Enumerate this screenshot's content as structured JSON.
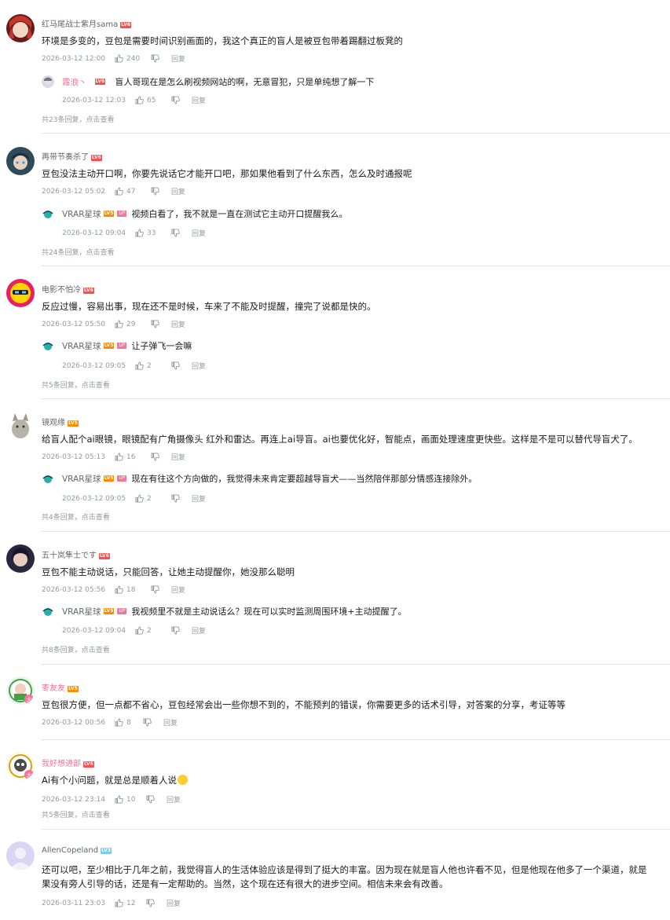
{
  "comments": [
    {
      "user": "红马尾战士紫月sama",
      "level": "LV6",
      "text": "环境是多变的，豆包是需要时间识别画面的，我这个真正的盲人是被豆包带着踢翻过板凳的",
      "time": "2026-03-12 12:00",
      "likes": "240",
      "reply_label": "回复",
      "reply": {
        "user": "霧浪丶",
        "level": "LV6",
        "up": "",
        "text": "盲人哥现在是怎么刷视频网站的啊，无意冒犯，只是单纯想了解一下",
        "time": "2026-03-12 12:03",
        "likes": "65",
        "reply_label": "回复"
      },
      "more": "共23条回复，点击查看"
    },
    {
      "user": "再带节奏杀了",
      "level": "LV6",
      "text": "豆包没法主动开口啊，你要先说话它才能开口吧，那如果他看到了什么东西，怎么及时通报呢",
      "time": "2026-03-12 05:02",
      "likes": "47",
      "reply_label": "回复",
      "reply": {
        "user": "VRAR星球",
        "level": "LV5",
        "up": "UP",
        "text": "视频白看了，我不就是一直在测试它主动开口提醒我么。",
        "time": "2026-03-12 09:04",
        "likes": "33",
        "reply_label": "回复"
      },
      "more": "共24条回复，点击查看"
    },
    {
      "user": "电影不怕冷",
      "level": "LV6",
      "text": "反应过慢，容易出事，现在还不是时候，车来了不能及时提醒，撞完了说都是快的。",
      "time": "2026-03-12 05:50",
      "likes": "29",
      "reply_label": "回复",
      "reply": {
        "user": "VRAR星球",
        "level": "LV5",
        "up": "UP",
        "text": "让子弹飞一会嘛",
        "time": "2026-03-12 09:05",
        "likes": "2",
        "reply_label": "回复"
      },
      "more": "共5条回复，点击查看"
    },
    {
      "user": "镜观缘",
      "level": "LV5",
      "text": "给盲人配个ai眼镜，眼镜配有广角摄像头 红外和雷达。再连上ai导盲。ai也要优化好，智能点，画面处理速度更快些。这样是不是可以替代导盲犬了。",
      "time": "2026-03-12 05:13",
      "likes": "16",
      "reply_label": "回复",
      "reply": {
        "user": "VRAR星球",
        "level": "LV5",
        "up": "UP",
        "text": "现在有往这个方向做的，我觉得未来肯定要超越导盲犬——当然陪伴那部分情感连接除外。",
        "time": "2026-03-12 09:05",
        "likes": "2",
        "reply_label": "回复"
      },
      "more": "共4条回复，点击查看"
    },
    {
      "user": "五十岚隼士です",
      "level": "LV6",
      "text": "豆包不能主动说话，只能回答，让她主动提醒你，她没那么聪明",
      "time": "2026-03-12 05:56",
      "likes": "18",
      "reply_label": "回复",
      "reply": {
        "user": "VRAR星球",
        "level": "LV5",
        "up": "UP",
        "text": "我视频里不就是主动说话么？现在可以实时监测周围环境+主动提醒了。",
        "time": "2026-03-12 09:04",
        "likes": "2",
        "reply_label": "回复"
      },
      "more": "共8条回复，点击查看"
    },
    {
      "user": "枣友友",
      "level": "LV5",
      "text": "豆包很方便，但一点都不省心，豆包经常会出一些你想不到的，不能预判的错误，你需要更多的话术引导，对答案的分享，考证等等",
      "time": "2026-03-12 00:56",
      "likes": "8",
      "reply_label": "回复"
    },
    {
      "user": "我好想进部",
      "level": "LV6",
      "text": "Ai有个小问题，就是总是顺着人说",
      "time": "2026-03-12 23:14",
      "likes": "10",
      "reply_label": "回复",
      "more": "共5条回复，点击查看"
    },
    {
      "user": "AllenCopeland",
      "level": "LV3",
      "text": "还可以吧，至少相比于几年之前，我觉得盲人的生活体验应该是得到了挺大的丰富。因为现在就是盲人他也许看不见，但是他现在他多了一个渠道，就是",
      "text2": "果没有旁人引导的话，还是有一定帮助的。当然，这个现在还有很大的进步空间。相信未来会有改善。",
      "time": "2026-03-11 23:03",
      "likes": "12",
      "reply_label": "回复"
    }
  ]
}
